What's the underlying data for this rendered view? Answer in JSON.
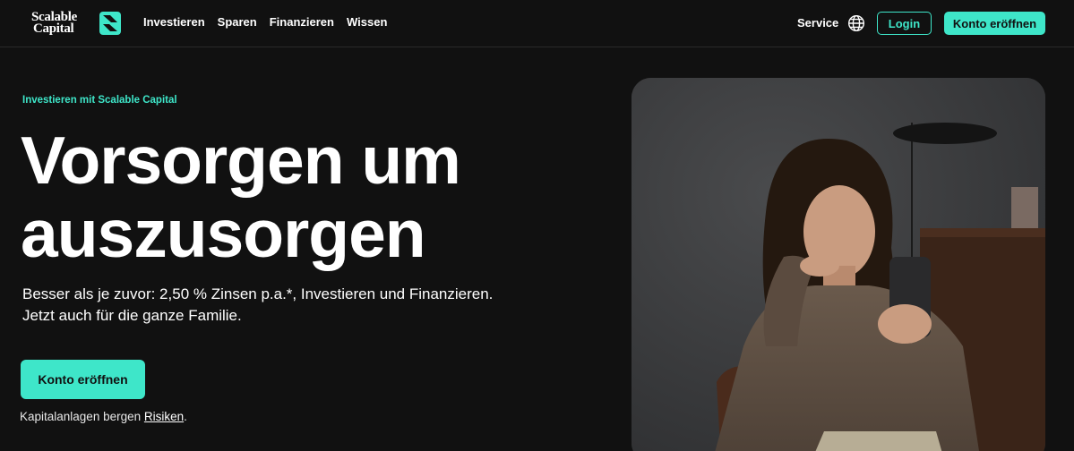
{
  "brand": {
    "logo_line1": "Scalable",
    "logo_line2": "Capital",
    "accent": "#3ee6c9",
    "background": "#111111"
  },
  "nav": {
    "items": [
      {
        "label": "Investieren"
      },
      {
        "label": "Sparen"
      },
      {
        "label": "Finanzieren"
      },
      {
        "label": "Wissen"
      }
    ],
    "service": "Service",
    "globe_icon": "globe-icon",
    "login": "Login",
    "open_account": "Konto eröffnen"
  },
  "hero": {
    "eyebrow": "Investieren mit Scalable Capital",
    "headline_line1": "Vorsorgen um",
    "headline_line2": "auszusorgen",
    "subline_line1": "Besser als je zuvor: 2,50 % Zinsen p.a.*, Investieren und Finanzieren.",
    "subline_line2": "Jetzt auch für die ganze Familie.",
    "cta": "Konto eröffnen",
    "risk_prefix": "Kapitalanlagen bergen ",
    "risk_link": "Risiken",
    "risk_suffix": "."
  }
}
